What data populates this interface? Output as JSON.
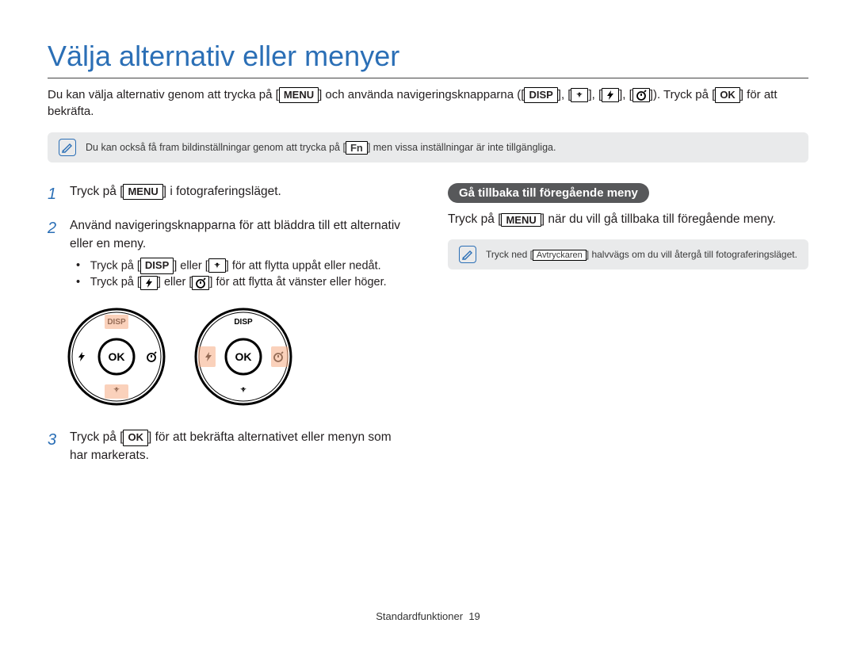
{
  "title": "Välja alternativ eller menyer",
  "intro": {
    "t1": "Du kan välja alternativ genom att trycka på [",
    "menu": "MENU",
    "t2": "] och använda navigeringsknapparna ([",
    "disp": "DISP",
    "t3": "], [",
    "t4": "], [",
    "t5": "], [",
    "t6": "]). Tryck på [",
    "ok": "OK",
    "t7": "] för att bekräfta."
  },
  "note1": {
    "t1": "Du kan också få fram bildinställningar genom att trycka på [",
    "fn": "Fn",
    "t2": "] men vissa inställningar är inte tillgängliga."
  },
  "left": {
    "step1": {
      "t1": "Tryck på [",
      "menu": "MENU",
      "t2": "] i fotograferingsläget."
    },
    "step2": {
      "main": "Använd navigeringsknapparna för att bläddra till ett alternativ eller en meny.",
      "b1a": "Tryck på [",
      "disp": "DISP",
      "b1b": "] eller [",
      "b1c": "] för att flytta uppåt eller nedåt.",
      "b2a": "Tryck på [",
      "b2b": "] eller [",
      "b2c": "] för att flytta åt vänster eller höger."
    },
    "step3": {
      "t1": "Tryck på [",
      "ok": "OK",
      "t2": "] för att bekräfta alternativet eller menyn som har markerats."
    }
  },
  "right": {
    "heading": "Gå tillbaka till föregående meny",
    "para": {
      "t1": "Tryck på [",
      "menu": "MENU",
      "t2": "] när du vill gå tillbaka till föregående meny."
    },
    "note": {
      "t1": "Tryck ned [",
      "av": "Avtryckaren",
      "t2": "] halvvägs om du vill återgå till fotograferingsläget."
    }
  },
  "dial": {
    "disp_label": "DISP",
    "ok_label": "OK"
  },
  "footer": {
    "section": "Standardfunktioner",
    "page": "19"
  }
}
